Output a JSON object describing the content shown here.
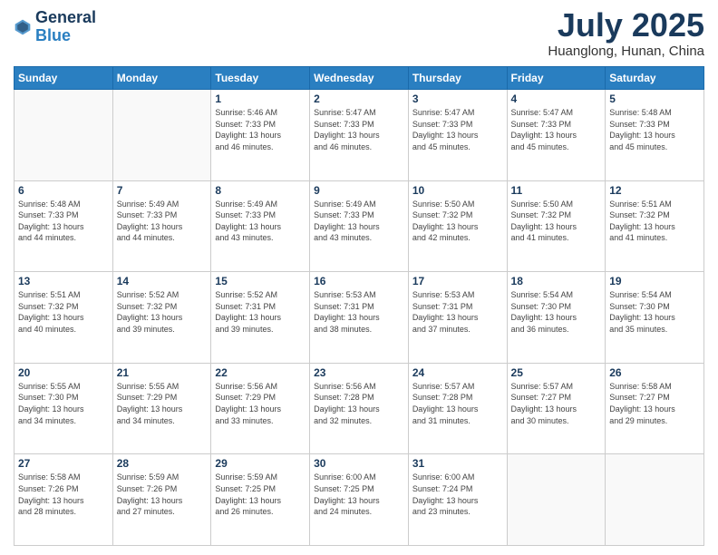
{
  "header": {
    "logo_line1": "General",
    "logo_line2": "Blue",
    "month": "July 2025",
    "location": "Huanglong, Hunan, China"
  },
  "days_of_week": [
    "Sunday",
    "Monday",
    "Tuesday",
    "Wednesday",
    "Thursday",
    "Friday",
    "Saturday"
  ],
  "weeks": [
    [
      {
        "day": "",
        "info": ""
      },
      {
        "day": "",
        "info": ""
      },
      {
        "day": "1",
        "info": "Sunrise: 5:46 AM\nSunset: 7:33 PM\nDaylight: 13 hours\nand 46 minutes."
      },
      {
        "day": "2",
        "info": "Sunrise: 5:47 AM\nSunset: 7:33 PM\nDaylight: 13 hours\nand 46 minutes."
      },
      {
        "day": "3",
        "info": "Sunrise: 5:47 AM\nSunset: 7:33 PM\nDaylight: 13 hours\nand 45 minutes."
      },
      {
        "day": "4",
        "info": "Sunrise: 5:47 AM\nSunset: 7:33 PM\nDaylight: 13 hours\nand 45 minutes."
      },
      {
        "day": "5",
        "info": "Sunrise: 5:48 AM\nSunset: 7:33 PM\nDaylight: 13 hours\nand 45 minutes."
      }
    ],
    [
      {
        "day": "6",
        "info": "Sunrise: 5:48 AM\nSunset: 7:33 PM\nDaylight: 13 hours\nand 44 minutes."
      },
      {
        "day": "7",
        "info": "Sunrise: 5:49 AM\nSunset: 7:33 PM\nDaylight: 13 hours\nand 44 minutes."
      },
      {
        "day": "8",
        "info": "Sunrise: 5:49 AM\nSunset: 7:33 PM\nDaylight: 13 hours\nand 43 minutes."
      },
      {
        "day": "9",
        "info": "Sunrise: 5:49 AM\nSunset: 7:33 PM\nDaylight: 13 hours\nand 43 minutes."
      },
      {
        "day": "10",
        "info": "Sunrise: 5:50 AM\nSunset: 7:32 PM\nDaylight: 13 hours\nand 42 minutes."
      },
      {
        "day": "11",
        "info": "Sunrise: 5:50 AM\nSunset: 7:32 PM\nDaylight: 13 hours\nand 41 minutes."
      },
      {
        "day": "12",
        "info": "Sunrise: 5:51 AM\nSunset: 7:32 PM\nDaylight: 13 hours\nand 41 minutes."
      }
    ],
    [
      {
        "day": "13",
        "info": "Sunrise: 5:51 AM\nSunset: 7:32 PM\nDaylight: 13 hours\nand 40 minutes."
      },
      {
        "day": "14",
        "info": "Sunrise: 5:52 AM\nSunset: 7:32 PM\nDaylight: 13 hours\nand 39 minutes."
      },
      {
        "day": "15",
        "info": "Sunrise: 5:52 AM\nSunset: 7:31 PM\nDaylight: 13 hours\nand 39 minutes."
      },
      {
        "day": "16",
        "info": "Sunrise: 5:53 AM\nSunset: 7:31 PM\nDaylight: 13 hours\nand 38 minutes."
      },
      {
        "day": "17",
        "info": "Sunrise: 5:53 AM\nSunset: 7:31 PM\nDaylight: 13 hours\nand 37 minutes."
      },
      {
        "day": "18",
        "info": "Sunrise: 5:54 AM\nSunset: 7:30 PM\nDaylight: 13 hours\nand 36 minutes."
      },
      {
        "day": "19",
        "info": "Sunrise: 5:54 AM\nSunset: 7:30 PM\nDaylight: 13 hours\nand 35 minutes."
      }
    ],
    [
      {
        "day": "20",
        "info": "Sunrise: 5:55 AM\nSunset: 7:30 PM\nDaylight: 13 hours\nand 34 minutes."
      },
      {
        "day": "21",
        "info": "Sunrise: 5:55 AM\nSunset: 7:29 PM\nDaylight: 13 hours\nand 34 minutes."
      },
      {
        "day": "22",
        "info": "Sunrise: 5:56 AM\nSunset: 7:29 PM\nDaylight: 13 hours\nand 33 minutes."
      },
      {
        "day": "23",
        "info": "Sunrise: 5:56 AM\nSunset: 7:28 PM\nDaylight: 13 hours\nand 32 minutes."
      },
      {
        "day": "24",
        "info": "Sunrise: 5:57 AM\nSunset: 7:28 PM\nDaylight: 13 hours\nand 31 minutes."
      },
      {
        "day": "25",
        "info": "Sunrise: 5:57 AM\nSunset: 7:27 PM\nDaylight: 13 hours\nand 30 minutes."
      },
      {
        "day": "26",
        "info": "Sunrise: 5:58 AM\nSunset: 7:27 PM\nDaylight: 13 hours\nand 29 minutes."
      }
    ],
    [
      {
        "day": "27",
        "info": "Sunrise: 5:58 AM\nSunset: 7:26 PM\nDaylight: 13 hours\nand 28 minutes."
      },
      {
        "day": "28",
        "info": "Sunrise: 5:59 AM\nSunset: 7:26 PM\nDaylight: 13 hours\nand 27 minutes."
      },
      {
        "day": "29",
        "info": "Sunrise: 5:59 AM\nSunset: 7:25 PM\nDaylight: 13 hours\nand 26 minutes."
      },
      {
        "day": "30",
        "info": "Sunrise: 6:00 AM\nSunset: 7:25 PM\nDaylight: 13 hours\nand 24 minutes."
      },
      {
        "day": "31",
        "info": "Sunrise: 6:00 AM\nSunset: 7:24 PM\nDaylight: 13 hours\nand 23 minutes."
      },
      {
        "day": "",
        "info": ""
      },
      {
        "day": "",
        "info": ""
      }
    ]
  ]
}
